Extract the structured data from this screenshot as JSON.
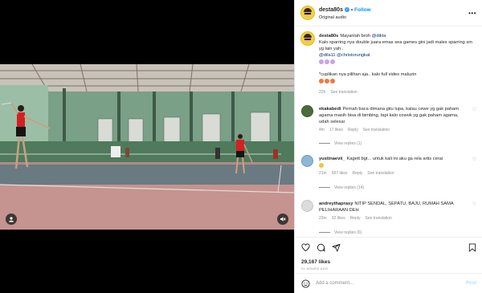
{
  "header": {
    "username": "desta80s",
    "follow_label": "Follow",
    "audio": "Original audio",
    "more_label": "•••"
  },
  "caption": {
    "username": "desta80s",
    "line1_text": "Mayanlah broh ",
    "line1_mention": "@dikta",
    "line2": "Kalo sparring nya double juara emas sea games gini jadi males sparring sm yg lain yah..",
    "mentions": "@dila11 @christorungkat",
    "line3": "*cuplikan nya pilihan aja.. kalo full video maluzin",
    "time": "22h",
    "see_translation": "See translation"
  },
  "comments": [
    {
      "username": "ekakabedi",
      "text": "Pernah baca dimana gitu lupa, kalau cewe yg gak paham agama masih bisa di bimbing, tapi kalo cowok yg gak paham agama, udah selesai",
      "time": "4m",
      "likes": "17 likes",
      "reply": "Reply",
      "see_translation": "See translation",
      "view_replies": "View replies (1)"
    },
    {
      "username": "yustinaevii_",
      "text": "Kagett bgt... untuk kali ini aku ga rela artis cerai",
      "time": "21m",
      "likes": "697 likes",
      "reply": "Reply",
      "see_translation": "See translation",
      "view_replies": "View replies (14)"
    },
    {
      "username": "andreythaprasy",
      "text": "NITIP SENDAL, SEPATU, BAJU, RUMAH SAMA PELIHARAAN DEH",
      "time": "23m",
      "likes": "32 likes",
      "reply": "Reply",
      "see_translation": "See translation",
      "view_replies": "View replies (6)"
    }
  ],
  "actions": {
    "likes": "29,167 likes",
    "time_ago": "21 HOURS AGO"
  },
  "add_comment": {
    "placeholder": "Add a comment...",
    "post_label": "Post"
  },
  "colors": {
    "accent": "#0095f6",
    "verified": "#3897f0",
    "muted": "#8e8e8e",
    "court_floor": "#b58a86",
    "wall": "#7aa087"
  }
}
